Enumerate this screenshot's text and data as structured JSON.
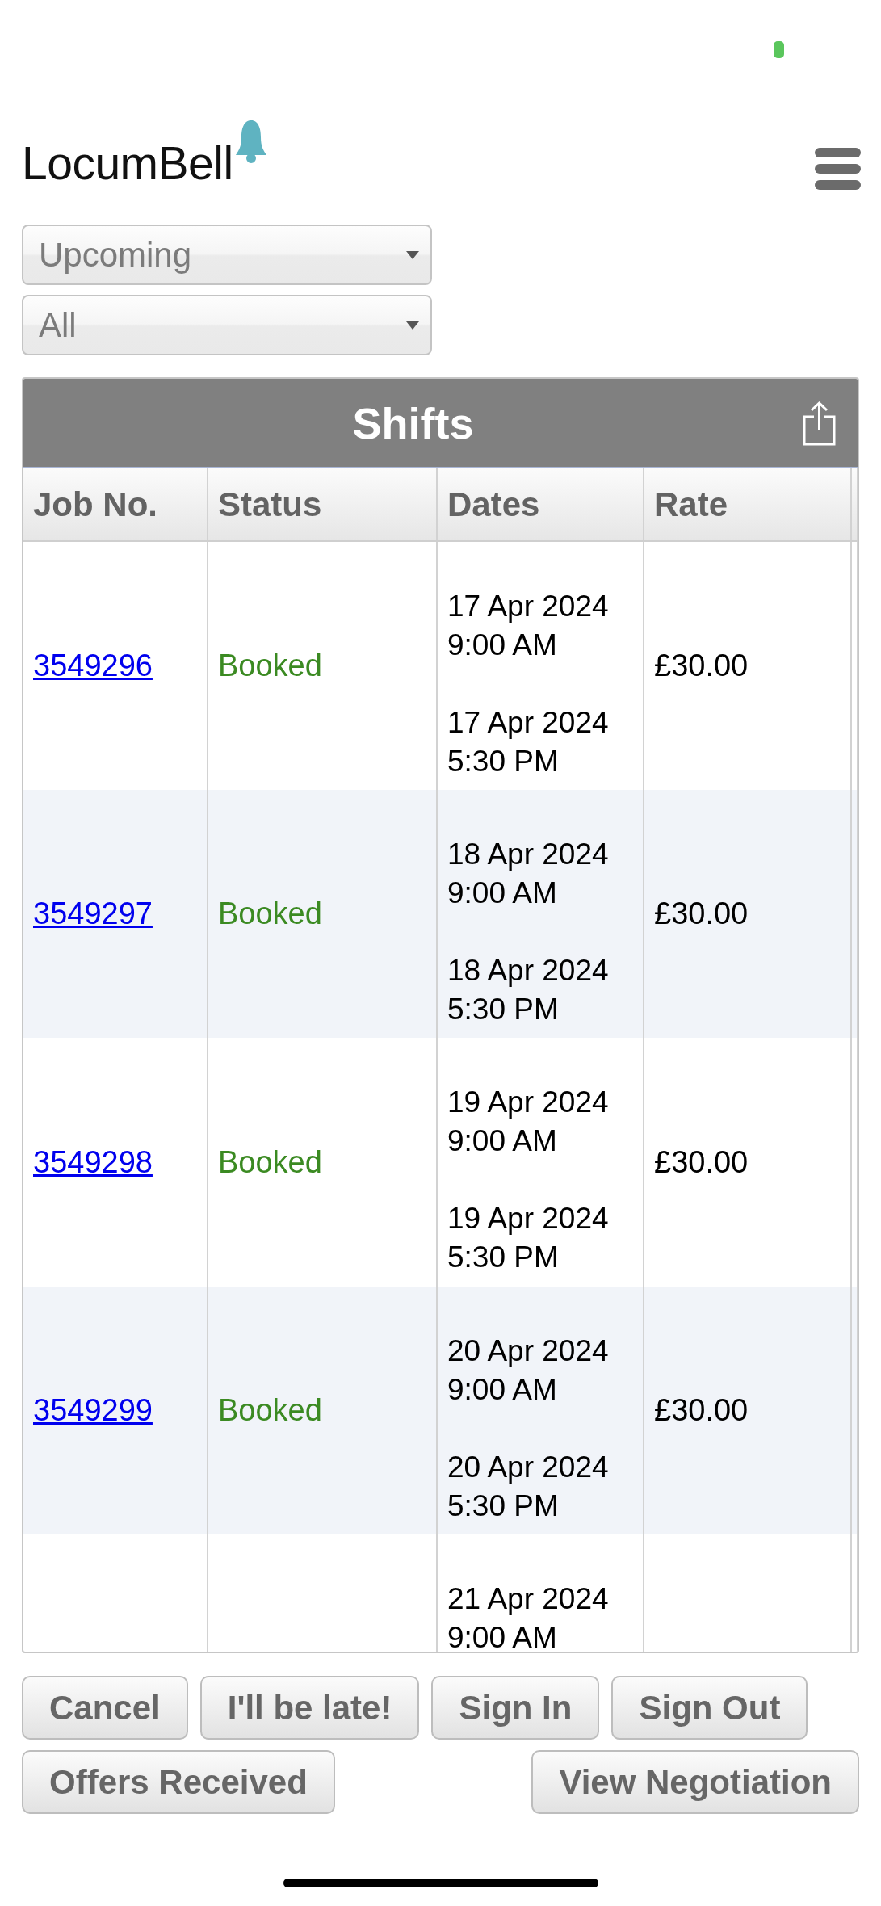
{
  "header": {
    "logo_text": "LocumBell"
  },
  "filters": [
    {
      "value": "Upcoming"
    },
    {
      "value": "All"
    }
  ],
  "shifts_table": {
    "title": "Shifts",
    "columns": [
      "Job No.",
      "Status",
      "Dates",
      "Rate"
    ],
    "rows": [
      {
        "job_no": "3549296",
        "status": "Booked",
        "dates": [
          {
            "date": "17 Apr 2024",
            "time": "9:00 AM"
          },
          {
            "date": "17 Apr 2024",
            "time": "5:30 PM"
          }
        ],
        "rate": "£30.00"
      },
      {
        "job_no": "3549297",
        "status": "Booked",
        "dates": [
          {
            "date": "18 Apr 2024",
            "time": "9:00 AM"
          },
          {
            "date": "18 Apr 2024",
            "time": "5:30 PM"
          }
        ],
        "rate": "£30.00"
      },
      {
        "job_no": "3549298",
        "status": "Booked",
        "dates": [
          {
            "date": "19 Apr 2024",
            "time": "9:00 AM"
          },
          {
            "date": "19 Apr 2024",
            "time": "5:30 PM"
          }
        ],
        "rate": "£30.00"
      },
      {
        "job_no": "3549299",
        "status": "Booked",
        "dates": [
          {
            "date": "20 Apr 2024",
            "time": "9:00 AM"
          },
          {
            "date": "20 Apr 2024",
            "time": "5:30 PM"
          }
        ],
        "rate": "£30.00"
      },
      {
        "dates": [
          {
            "date": "21 Apr 2024",
            "time": "9:00 AM"
          }
        ]
      }
    ]
  },
  "button_rows": [
    [
      "Cancel",
      "I'll be late!",
      "Sign In",
      "Sign Out"
    ],
    [
      "Offers Received",
      "View Negotiation"
    ]
  ]
}
